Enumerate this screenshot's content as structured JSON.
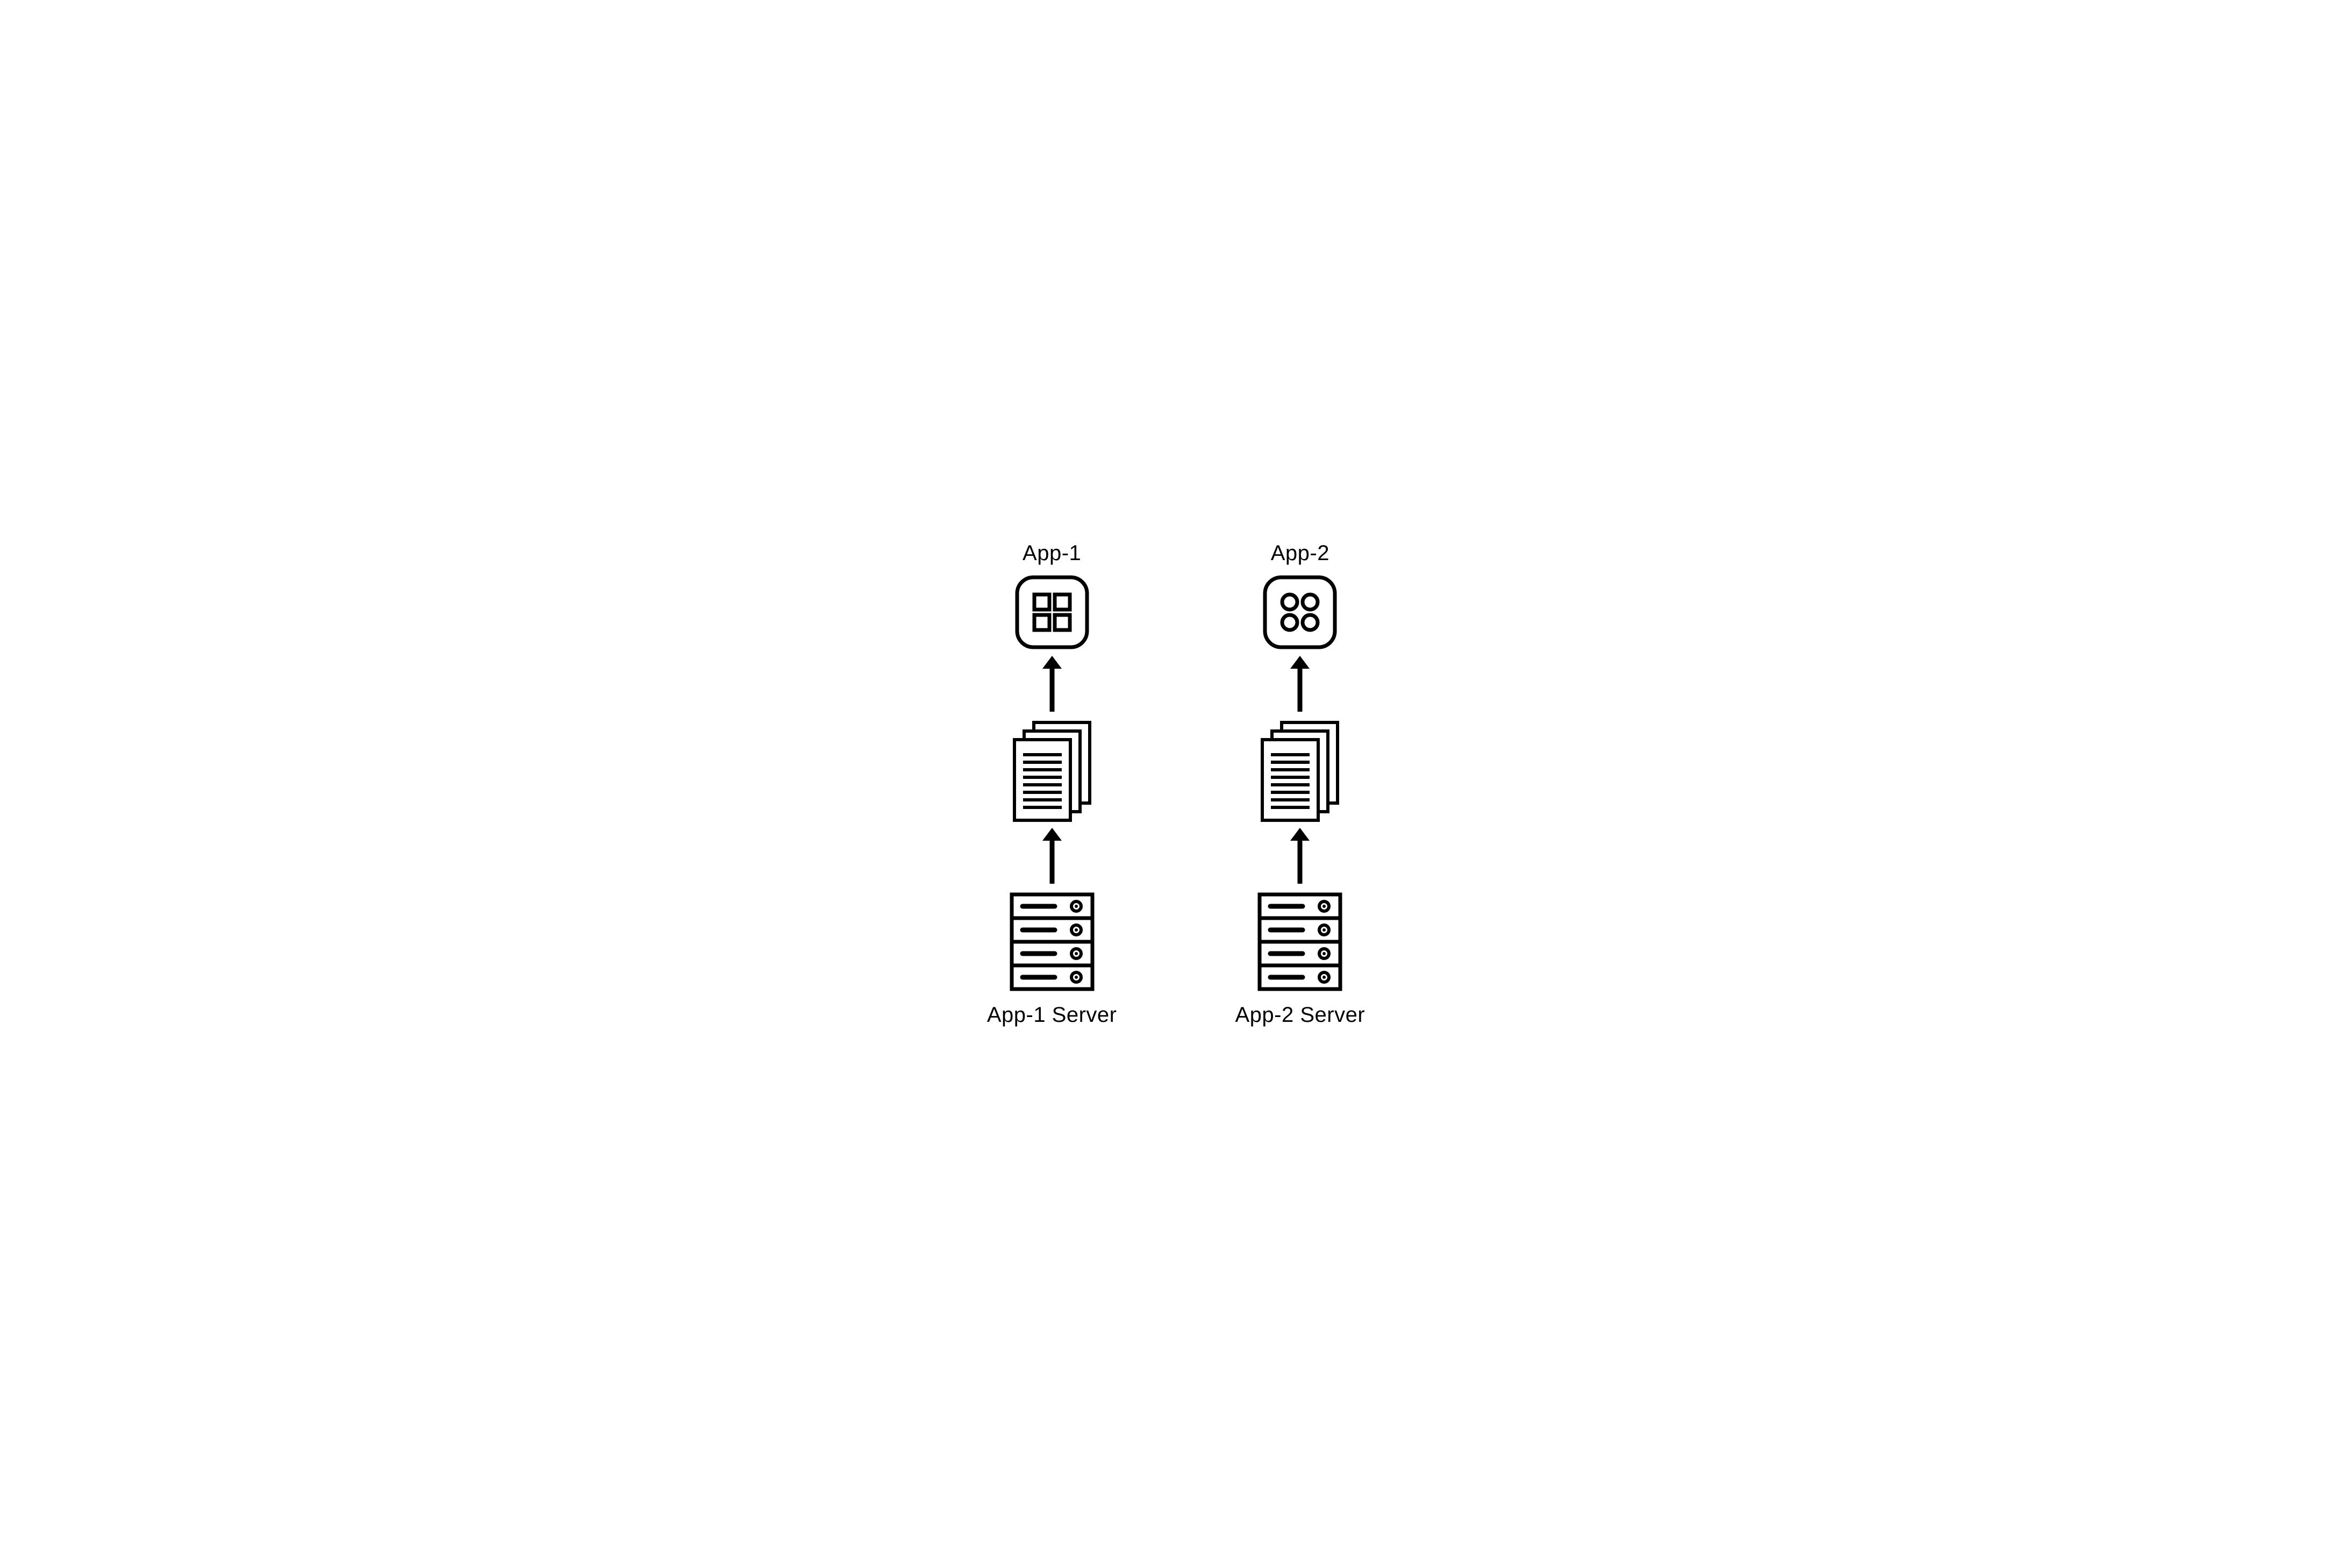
{
  "diagram": {
    "columns": [
      {
        "top_label": "App-1",
        "bottom_label": "App-1 Server",
        "app_icon": "squares-app-icon"
      },
      {
        "top_label": "App-2",
        "bottom_label": "App-2 Server",
        "app_icon": "circles-app-icon"
      }
    ],
    "icons": {
      "squares-app-icon": "Rounded square containing four small squares",
      "circles-app-icon": "Rounded square containing four small circles",
      "documents-icon": "Stack of three overlapping documents with text lines",
      "server-rack-icon": "Server rack with four units",
      "up-arrow-icon": "Upward pointing arrow"
    }
  }
}
